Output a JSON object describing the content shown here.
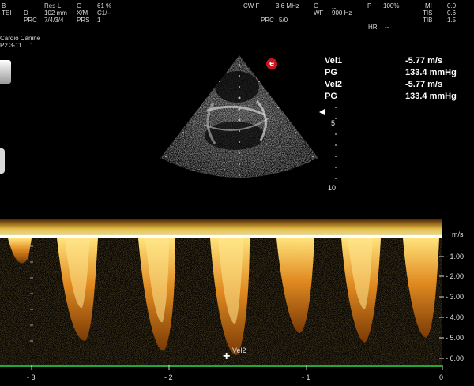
{
  "top_left": {
    "col1": [
      "B",
      "TEI"
    ],
    "col2": [
      "D",
      "PRC"
    ],
    "col3": [
      "Res-L",
      "102 mm",
      "7/4/3/4"
    ],
    "col4": [
      "G",
      "X/M",
      "PRS"
    ],
    "col5": [
      "61 %",
      "C1/--",
      "1"
    ],
    "preset": "Cardio Canine",
    "probe": "P2 3-11",
    "probe_num": "1"
  },
  "top_center": {
    "mode": "CW F",
    "freq": "3.6 MHz",
    "g_label": "G",
    "g_value": "--",
    "wf_label": "WF",
    "wf_value": "900 Hz",
    "prc": "PRC",
    "prc_value": "5/0"
  },
  "top_right": {
    "p_label": "P",
    "p_value": "100%",
    "mi_label": "MI",
    "mi_value": "0.0",
    "tis_label": "TIS",
    "tis_value": "0.6",
    "tib_label": "TIB",
    "tib_value": "1.5",
    "hr_label": "HR",
    "hr_value": "--"
  },
  "measurements": [
    {
      "label": "Vel1",
      "value": "-5.77 m/s"
    },
    {
      "label": "PG",
      "value": "133.4 mmHg"
    },
    {
      "label": "Vel2",
      "value": "-5.77 m/s"
    },
    {
      "label": "PG",
      "value": "133.4 mmHg"
    }
  ],
  "depth_labels": [
    "5",
    "10"
  ],
  "velocity_scale": {
    "unit": "m/s",
    "ticks": [
      "- 1.00",
      "- 2.00",
      "- 3.00",
      "- 4.00",
      "- 5.00",
      "- 6.00"
    ]
  },
  "time_axis": [
    "- 3",
    "- 2",
    "- 1",
    "0"
  ],
  "cursor_label": "Vel2",
  "logo_letter": "e",
  "colors": {
    "spectrum_hot": "#ffcf40",
    "spectrum_mid": "#c86a10",
    "baseline_green": "#22a83a",
    "logo_red": "#c4161c"
  }
}
